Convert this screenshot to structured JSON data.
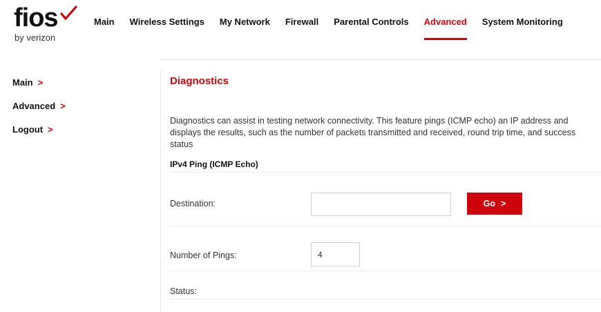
{
  "brand": {
    "wordmark": "fios",
    "tagline": "by verizon",
    "accent_color": "#cd040b",
    "check_icon": "checkmark-icon"
  },
  "topnav": {
    "items": [
      {
        "label": "Main",
        "active": false
      },
      {
        "label": "Wireless Settings",
        "active": false
      },
      {
        "label": "My Network",
        "active": false
      },
      {
        "label": "Firewall",
        "active": false
      },
      {
        "label": "Parental Controls",
        "active": false
      },
      {
        "label": "Advanced",
        "active": true
      },
      {
        "label": "System Monitoring",
        "active": false
      }
    ]
  },
  "sidebar": {
    "items": [
      {
        "label": "Main",
        "icon": "chevron-right-icon"
      },
      {
        "label": "Advanced",
        "icon": "chevron-right-icon"
      },
      {
        "label": "Logout",
        "icon": "chevron-right-icon"
      }
    ],
    "chevron_glyph": ">"
  },
  "main": {
    "title": "Diagnostics",
    "description": "Diagnostics can assist in testing network connectivity. This feature pings (ICMP echo) an IP address and displays the results, such as the number of packets transmitted and received, round trip time, and success status",
    "section_heading": "IPv4 Ping (ICMP Echo)",
    "destination": {
      "label": "Destination:",
      "value": "",
      "placeholder": ""
    },
    "go_button": {
      "label": "Go",
      "icon": "chevron-right-icon",
      "glyph": ">"
    },
    "pings": {
      "label": "Number of Pings:",
      "value": "4"
    },
    "status": {
      "label": "Status:"
    }
  }
}
